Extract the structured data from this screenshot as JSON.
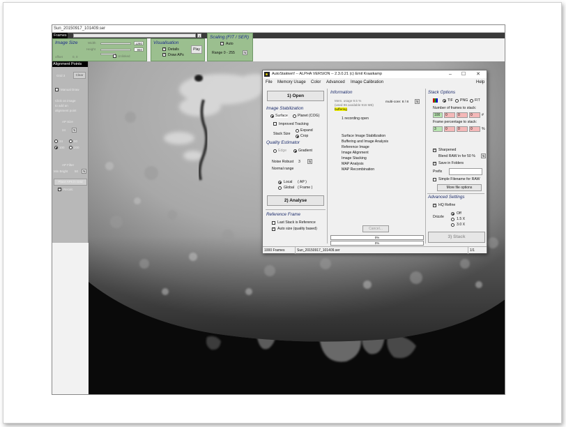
{
  "window": {
    "title": "Sun_20150917_101409.ser"
  },
  "frames_bar": {
    "label": "Frames",
    "value": "1"
  },
  "image_size": {
    "title": "Image Size",
    "width_label": "Width",
    "width_value": "1280",
    "height_label": "Height",
    "height_value": "960",
    "offset_label": "offset",
    "offset_value": "0, 0",
    "unlinked_label": "Unlinked"
  },
  "visualisation": {
    "title": "Visualisation",
    "details_label": "Details",
    "draw_aps_label": "Draw APs",
    "play_label": "Play"
  },
  "scaling": {
    "title": "Scaling (FIT / SER)",
    "auto_label": "Auto",
    "range_label": "Range 0 - 255"
  },
  "alignment_points": {
    "header": "Alignment Points",
    "clear_label": "Clear",
    "manual_draw_label": "Manual Draw",
    "hint_text": [
      "Click on image",
      "to add an",
      "alignment point"
    ],
    "ap_size_label": "AP Size",
    "ap_size_value": "24",
    "size_options": [
      "24",
      "50",
      "100",
      "200"
    ],
    "min_bright_label": "AP Filter",
    "min_bright_field": "Min Bright",
    "min_bright_value": "50",
    "place_grid_label": "Place APs in Grid",
    "recalc_label": "Recalc"
  },
  "dialog": {
    "title": "AutoStakkert! -- ALPHA VERSION -- 2.3.0.21  (c) Emil Kraaikamp",
    "menu": [
      "File",
      "Memory Usage",
      "Color",
      "Advanced",
      "Image Calibration",
      "Help"
    ],
    "open_button": "1) Open",
    "image_stabilization": {
      "title": "Image Stabilization",
      "surface_label": "Surface",
      "planet_label": "Planet (COG)",
      "improved_tracking_label": "Improved Tracking",
      "stack_size_label": "Stack Size",
      "expand_label": "Expand",
      "crop_label": "Crop"
    },
    "quality_estimator": {
      "title": "Quality Estimator",
      "edge_label": "Edge",
      "gradient_label": "Gradient",
      "noise_robust_label": "Noise Robust",
      "noise_robust_value": "3",
      "normal_range_label": "Normal range",
      "local_label": "Local",
      "local_suffix": "( AP )",
      "global_label": "Global",
      "global_suffix": "( Frame )"
    },
    "analyse_button": "2) Analyse",
    "reference_frame": {
      "title": "Reference Frame",
      "last_stack_label": "Last Stack is Reference",
      "auto_size_label": "Auto size (quality based)"
    },
    "information": {
      "title": "Information",
      "mem_line1": "Mem. usage 9.5 %",
      "mem_line2": "(used 96 available 916 MB)",
      "buffering": "buffering",
      "multicore": "multi-core: 8 / 8",
      "recording_open": "1 recording open",
      "steps": [
        "Surface Image Stabilization",
        "Buffering and Image Analysis",
        "Reference Image",
        "Image Alignment",
        "Image Stacking",
        "MAP Analysis",
        "MAP Recombination"
      ],
      "cancel_label": "Cancel...",
      "progress1": "0%",
      "progress2": "0%",
      "progress1_fraction": 0,
      "progress2_fraction": 0
    },
    "stack_options": {
      "title": "Stack Options",
      "tif_label": "TIF",
      "png_label": "PNG",
      "fit_label": "FIT",
      "frames_to_stack_label": "Number of frames to stack:",
      "frames_values": [
        "100",
        "0",
        "0",
        "0"
      ],
      "frames_unit": "#",
      "percentage_label": "Frame percentage to stack:",
      "percentage_values": [
        "3",
        "0",
        "0",
        "0"
      ],
      "percentage_unit": "%",
      "sharpened_label": "Sharpened",
      "blend_label": "Blend RAW in for 50 %",
      "save_folders_label": "Save in Folders",
      "prefix_label": "Prefix",
      "prefix_value": "",
      "simple_filename_label": "Simple Filename for RAW",
      "more_options_label": "More file options"
    },
    "advanced_settings": {
      "title": "Advanced Settings",
      "hq_refine_label": "HQ Refine",
      "drizzle_label": "Drizzle",
      "off_label": "Off",
      "x15_label": "1.5 X",
      "x30_label": "3.0 X"
    },
    "stack_button": "3) Stack",
    "status": {
      "frames": "1000 Frames",
      "filename": "Sun_20150917_101409.ser",
      "page": "1/1"
    }
  },
  "colors": {
    "panel_green": "#9bbf8f",
    "heading_blue": "#1a2a6a",
    "buffering_yellow": "#f7f700",
    "frames_green": "#b8e4b0",
    "frames_red": "#f4b8b8"
  }
}
